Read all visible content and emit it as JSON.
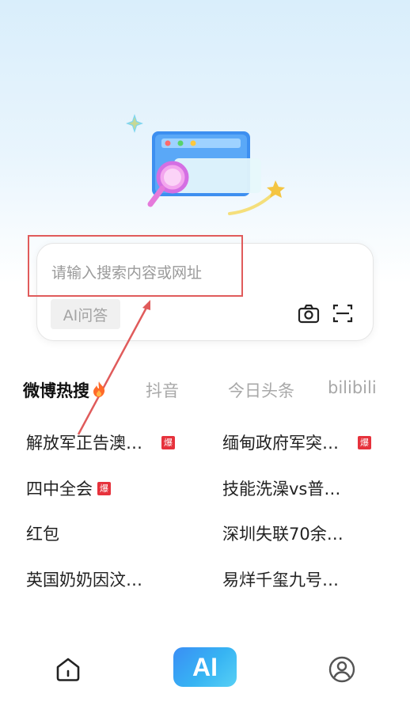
{
  "search": {
    "placeholder": "请输入搜索内容或网址",
    "ai_qa_label": "AI问答"
  },
  "icons": {
    "camera": "camera-icon",
    "scan": "scan-icon",
    "home": "home-icon",
    "profile": "profile-icon",
    "fire": "fire-icon"
  },
  "tabs": [
    {
      "label": "微博热搜",
      "active": true
    },
    {
      "label": "抖音",
      "active": false
    },
    {
      "label": "今日头条",
      "active": false
    },
    {
      "label": "bilibili",
      "active": false
    }
  ],
  "hot_list": [
    {
      "title": "解放军正告澳…",
      "badge": "爆"
    },
    {
      "title": "缅甸政府军突…",
      "badge": "爆"
    },
    {
      "title": "四中全会",
      "badge": "爆"
    },
    {
      "title": "技能洗澡vs普…",
      "badge": ""
    },
    {
      "title": "红包",
      "badge": ""
    },
    {
      "title": "深圳失联70余…",
      "badge": ""
    },
    {
      "title": "英国奶奶因汶…",
      "badge": ""
    },
    {
      "title": "易烊千玺九号…",
      "badge": ""
    }
  ],
  "bottom_nav": {
    "ai_label": "AI"
  },
  "colors": {
    "accent": "#3a8ef5",
    "hot_badge": "#e6323c",
    "annotation": "#e05b5b"
  }
}
